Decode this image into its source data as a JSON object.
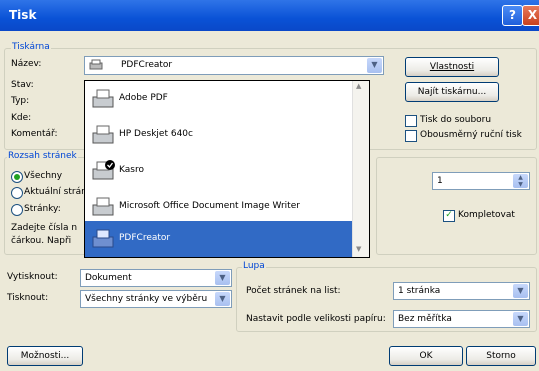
{
  "window": {
    "title": "Tisk",
    "help": "?",
    "close": "X"
  },
  "printer": {
    "legend": "Tiskárna",
    "name_label": "Název:",
    "selected": "PDFCreator",
    "status_label": "Stav:",
    "type_label": "Typ:",
    "where_label": "Kde:",
    "comment_label": "Komentář:",
    "properties_button": "Vlastnosti",
    "find_button": "Najít tiskárnu...",
    "print_to_file": "Tisk do souboru",
    "duplex": "Obousměrný ruční tisk",
    "dropdown_items": [
      "Adobe PDF",
      "HP Deskjet 640c",
      "Kasro",
      "Microsoft Office Document Image Writer",
      "PDFCreator"
    ]
  },
  "range": {
    "legend": "Rozsah stránek",
    "all": "Všechny",
    "current": "Aktuální stránka",
    "pages": "Stránky:",
    "hint1": "Zadejte čísla n",
    "hint2": "čárkou. Napři"
  },
  "copies": {
    "count": "1",
    "collate": "Kompletovat"
  },
  "print_what": {
    "label": "Vytisknout:",
    "value": "Dokument"
  },
  "print": {
    "label": "Tisknout:",
    "value": "Všechny stránky ve výběru"
  },
  "zoom": {
    "legend": "Lupa",
    "pages_label": "Počet stránek na list:",
    "pages_value": "1 stránka",
    "scale_label": "Nastavit podle velikosti papíru:",
    "scale_value": "Bez měřítka"
  },
  "buttons": {
    "options": "Možnosti...",
    "ok": "OK",
    "cancel": "Storno"
  }
}
